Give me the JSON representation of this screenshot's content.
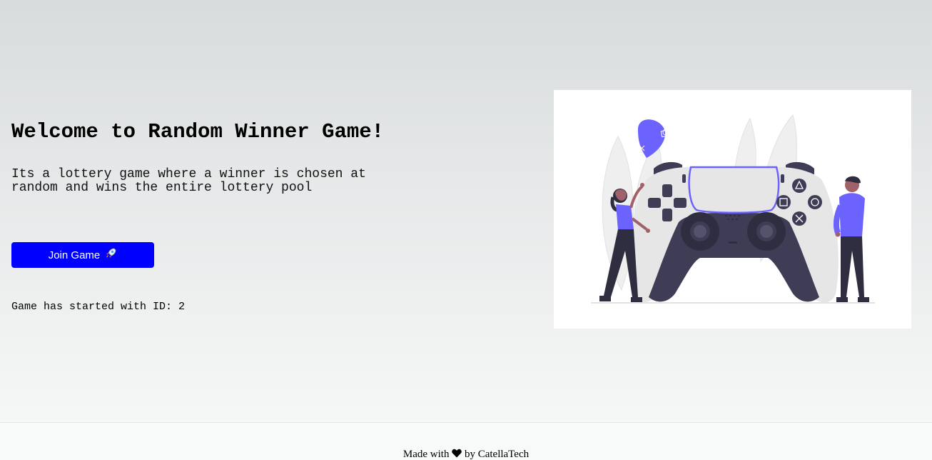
{
  "main": {
    "title": "Welcome to Random Winner Game!",
    "description": "Its a lottery game where a winner is chosen at random and wins the entire lottery pool",
    "join_button": {
      "label": "Join Game",
      "icon": "rocket-icon"
    },
    "status": "Game has started with ID: 2"
  },
  "illustration": {
    "icon": "gamers-controller-illustration",
    "accent_color": "#6c63ff"
  },
  "footer": {
    "prefix": "Made with",
    "icon": "heart-icon",
    "suffix": "by CatellaTech"
  },
  "colors": {
    "button_bg": "#0000ff",
    "button_text": "#ffffff"
  }
}
